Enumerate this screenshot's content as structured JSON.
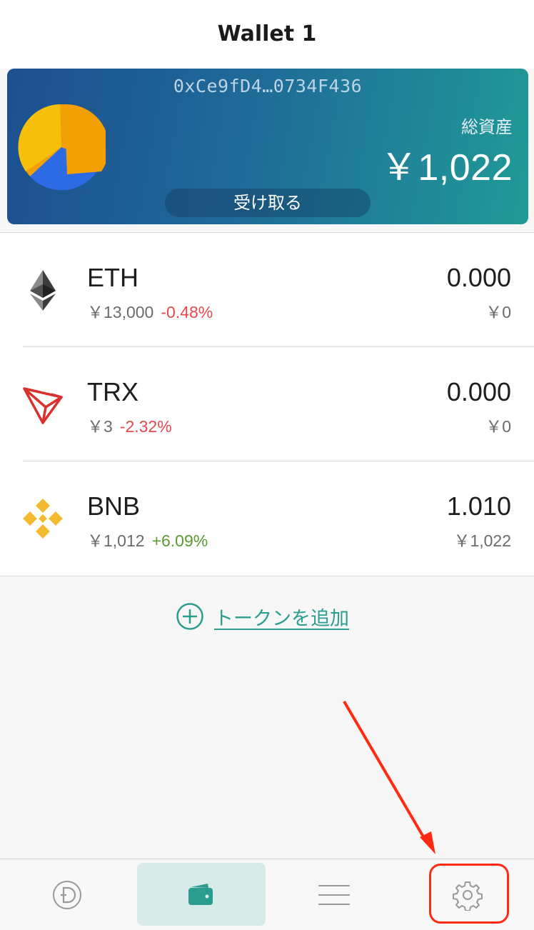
{
  "header": {
    "title": "Wallet 1"
  },
  "card": {
    "address": "0xCe9fD4…0734F436",
    "total_label": "総資産",
    "total_value": "￥1,022",
    "receive_label": "受け取る",
    "pie_colors": [
      "#f2a005",
      "#2d6be4",
      "#f6c00a"
    ]
  },
  "tokens": [
    {
      "symbol": "ETH",
      "price": "￥13,000",
      "change": "-0.48%",
      "balance": "0.000",
      "value": "￥0",
      "icon": "ethereum-icon"
    },
    {
      "symbol": "TRX",
      "price": "￥3",
      "change": "-2.32%",
      "balance": "0.000",
      "value": "￥0",
      "icon": "tron-icon"
    },
    {
      "symbol": "BNB",
      "price": "￥1,012",
      "change": "+6.09%",
      "balance": "1.010",
      "value": "￥1,022",
      "icon": "binance-icon"
    }
  ],
  "add_token": {
    "label": "トークンを追加"
  },
  "bottom_nav": {
    "items": [
      {
        "name": "dapp",
        "icon": "dapp-coin-icon"
      },
      {
        "name": "wallet",
        "icon": "wallet-icon",
        "active": true
      },
      {
        "name": "menu",
        "icon": "menu-lines-icon"
      },
      {
        "name": "settings",
        "icon": "gear-icon"
      }
    ]
  },
  "colors": {
    "accent": "#2a9d8f",
    "negative": "#e5484d",
    "positive": "#5b9a33",
    "annotation": "#ff2a12"
  }
}
